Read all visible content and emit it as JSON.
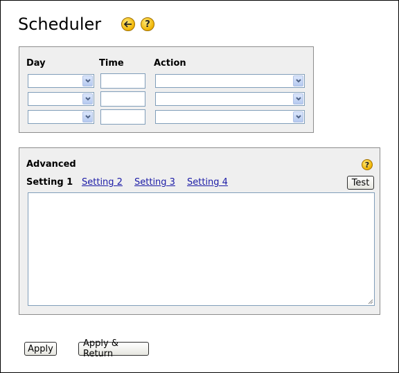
{
  "page": {
    "title": "Scheduler"
  },
  "header_icons": {
    "back": "arrow-left-icon",
    "help": "question-icon"
  },
  "schedule": {
    "headers": {
      "day": "Day",
      "time": "Time",
      "action": "Action"
    },
    "rows": [
      {
        "day": "",
        "time": "",
        "action": ""
      },
      {
        "day": "",
        "time": "",
        "action": ""
      },
      {
        "day": "",
        "time": "",
        "action": ""
      }
    ]
  },
  "advanced": {
    "title": "Advanced",
    "tabs": [
      "Setting 1",
      "Setting 2",
      "Setting 3",
      "Setting 4"
    ],
    "active_tab": "Setting 1",
    "test_label": "Test",
    "content": ""
  },
  "footer": {
    "apply_label": "Apply",
    "apply_return_label": "Apply & Return"
  },
  "colors": {
    "link": "#1a1aa6",
    "panel_bg": "#efefef",
    "icon": "#f0b400"
  }
}
